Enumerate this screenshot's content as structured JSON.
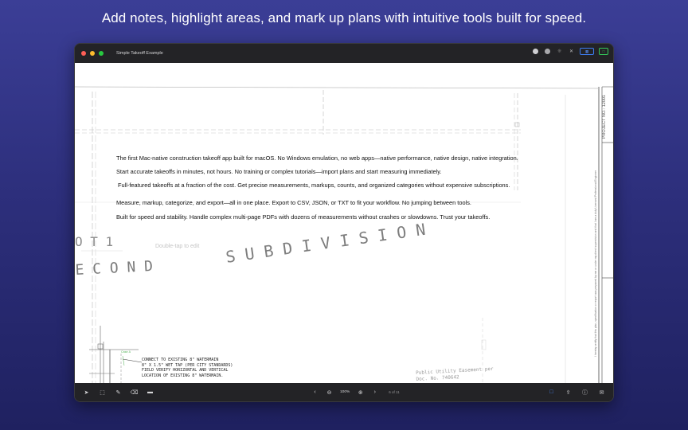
{
  "headline": "Add notes, highlight areas, and mark up plans with intuitive tools built for speed.",
  "window": {
    "title": "Simple Takeoff Example",
    "traffic_colors": [
      "#ff5f57",
      "#febc2e",
      "#28c840"
    ]
  },
  "toolbar_top": {
    "icons": [
      "clock-icon",
      "target-icon",
      "sparkle-icon",
      "close-icon"
    ],
    "badge_blue_icon": "sidebar-icon",
    "badge_green_icon": "folder-icon"
  },
  "notes": [
    "The first Mac-native construction takeoff app built for macOS. No Windows emulation, no web apps—native performance, native design, native integration.",
    "Start accurate takeoffs in minutes, not hours. No training or complex tutorials—import plans and start measuring immediately.",
    "Full-featured takeoffs at a fraction of the cost. Get precise measurements, markups, counts, and organized categories without expensive subscriptions.",
    "Measure, markup, categorize, and export—all in one place. Export to CSV, JSON, or TXT to fit your workflow. No jumping between tools.",
    "Built for speed and stability. Handle complex multi-page PDFs with dozens of measurements without crashes or slowdowns. Trust your takeoffs."
  ],
  "hint": "Double-tap to edit",
  "plan": {
    "subdivision_text": "S U B D I V I S I O N",
    "second_text": "E C O N D",
    "lot_text": "O T   1",
    "project_no": "PROJECT NO.: 12001",
    "cert_text": "I hereby certify that this plan, specification or report was prepared by me or under my direct supervision and that I am a duly Licensed Professional Engineer",
    "watermain": [
      "CONNECT TO EXISTING 8\" WATERMAIN",
      "8\" X 1.5\" WET TAP (PER CITY STANDARDS)",
      "FIELD VERIFY HORIZONTAL AND VERTICAL",
      "LOCATION OF EXISTING 8\" WATERMAIN."
    ],
    "utility": [
      "Public Utility Easement per",
      "Doc. No. 740642"
    ]
  },
  "bottombar": {
    "zoom": "100%",
    "page": "6 of 11"
  }
}
